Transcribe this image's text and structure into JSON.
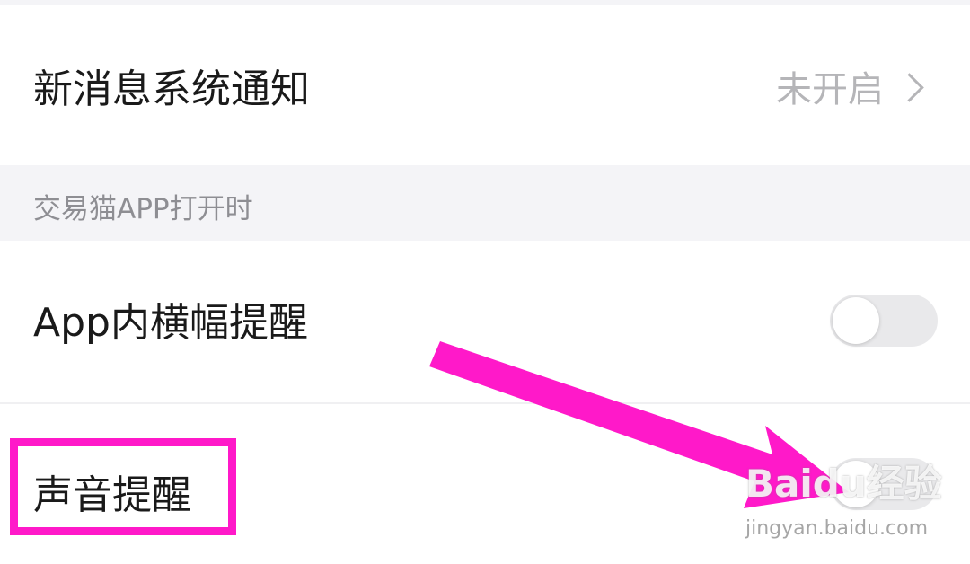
{
  "settings": {
    "new_message_notification": {
      "label": "新消息系统通知",
      "value": "未开启"
    },
    "section_header": "交易猫APP打开时",
    "in_app_banner": {
      "label": "App内横幅提醒",
      "enabled": false
    },
    "sound_alert": {
      "label": "声音提醒",
      "enabled": false
    }
  },
  "annotation": {
    "color": "#ff19c9"
  },
  "watermark": {
    "brand": "Baidu经验",
    "url": "jingyan.baidu.com"
  }
}
